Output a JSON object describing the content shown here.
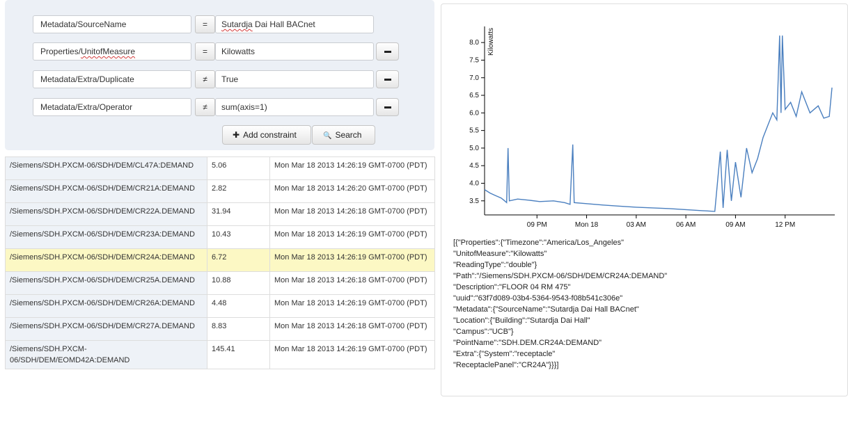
{
  "constraints": [
    {
      "field": "Metadata/SourceName",
      "op": "=",
      "value": "Sutardja Dai Hall BACnet",
      "removable": false
    },
    {
      "field": "Properties/UnitofMeasure",
      "op": "=",
      "value": "Kilowatts",
      "removable": true
    },
    {
      "field": "Metadata/Extra/Duplicate",
      "op": "≠",
      "value": "True",
      "removable": true
    },
    {
      "field": "Metadata/Extra/Operator",
      "op": "≠",
      "value": "sum(axis=1)",
      "removable": true
    }
  ],
  "buttons": {
    "add_icon": "✚",
    "add_label": "Add constraint",
    "search_icon": "🔍",
    "search_label": "Search"
  },
  "results": [
    {
      "path": "/Siemens/SDH.PXCM-06/SDH/DEM/CL47A:DEMAND",
      "value": "5.06",
      "time": "Mon Mar 18 2013 14:26:19 GMT-0700 (PDT)"
    },
    {
      "path": "/Siemens/SDH.PXCM-06/SDH/DEM/CR21A:DEMAND",
      "value": "2.82",
      "time": "Mon Mar 18 2013 14:26:20 GMT-0700 (PDT)"
    },
    {
      "path": "/Siemens/SDH.PXCM-06/SDH/DEM/CR22A.DEMAND",
      "value": "31.94",
      "time": "Mon Mar 18 2013 14:26:18 GMT-0700 (PDT)"
    },
    {
      "path": "/Siemens/SDH.PXCM-06/SDH/DEM/CR23A:DEMAND",
      "value": "10.43",
      "time": "Mon Mar 18 2013 14:26:19 GMT-0700 (PDT)"
    },
    {
      "path": "/Siemens/SDH.PXCM-06/SDH/DEM/CR24A:DEMAND",
      "value": "6.72",
      "time": "Mon Mar 18 2013 14:26:19 GMT-0700 (PDT)",
      "highlighted": true
    },
    {
      "path": "/Siemens/SDH.PXCM-06/SDH/DEM/CR25A.DEMAND",
      "value": "10.88",
      "time": "Mon Mar 18 2013 14:26:18 GMT-0700 (PDT)"
    },
    {
      "path": "/Siemens/SDH.PXCM-06/SDH/DEM/CR26A:DEMAND",
      "value": "4.48",
      "time": "Mon Mar 18 2013 14:26:19 GMT-0700 (PDT)"
    },
    {
      "path": "/Siemens/SDH.PXCM-06/SDH/DEM/CR27A.DEMAND",
      "value": "8.83",
      "time": "Mon Mar 18 2013 14:26:18 GMT-0700 (PDT)"
    },
    {
      "path": "/Siemens/SDH.PXCM-06/SDH/DEM/EOMD42A:DEMAND",
      "value": "145.41",
      "time": "Mon Mar 18 2013 14:26:19 GMT-0700 (PDT)"
    }
  ],
  "chart_data": {
    "type": "line",
    "ylabel": "Kilowatts",
    "xlabel": "",
    "title": "",
    "ylim": [
      3.1,
      8.3
    ],
    "yticks": [
      3.5,
      4.0,
      4.5,
      5.0,
      5.5,
      6.0,
      6.5,
      7.0,
      7.5,
      8.0
    ],
    "xlim": [
      "Mar 17 17:50",
      "Mar 18 15:00"
    ],
    "xticks": [
      {
        "t": "Mar 17 21:00",
        "label": "09 PM"
      },
      {
        "t": "Mar 18 00:00",
        "label": "Mon 18"
      },
      {
        "t": "Mar 18 03:00",
        "label": "03 AM"
      },
      {
        "t": "Mar 18 06:00",
        "label": "06 AM"
      },
      {
        "t": "Mar 18 09:00",
        "label": "09 AM"
      },
      {
        "t": "Mar 18 12:00",
        "label": "12 PM"
      }
    ],
    "series_color": "#4a7fbf",
    "series": [
      {
        "name": "",
        "points": [
          [
            "Mar 17 17:50",
            3.82
          ],
          [
            "Mar 17 18:10",
            3.72
          ],
          [
            "Mar 17 18:30",
            3.65
          ],
          [
            "Mar 17 18:50",
            3.58
          ],
          [
            "Mar 17 19:00",
            3.52
          ],
          [
            "Mar 17 19:10",
            3.45
          ],
          [
            "Mar 17 19:15",
            5.0
          ],
          [
            "Mar 17 19:20",
            3.5
          ],
          [
            "Mar 17 19:50",
            3.55
          ],
          [
            "Mar 17 20:30",
            3.52
          ],
          [
            "Mar 17 21:10",
            3.48
          ],
          [
            "Mar 17 22:00",
            3.5
          ],
          [
            "Mar 17 22:40",
            3.45
          ],
          [
            "Mar 17 23:00",
            3.4
          ],
          [
            "Mar 17 23:10",
            5.1
          ],
          [
            "Mar 17 23:15",
            3.45
          ],
          [
            "Mar 18 00:00",
            3.42
          ],
          [
            "Mar 18 01:00",
            3.38
          ],
          [
            "Mar 18 02:00",
            3.35
          ],
          [
            "Mar 18 03:00",
            3.32
          ],
          [
            "Mar 18 04:00",
            3.3
          ],
          [
            "Mar 18 05:00",
            3.28
          ],
          [
            "Mar 18 06:00",
            3.25
          ],
          [
            "Mar 18 07:00",
            3.22
          ],
          [
            "Mar 18 07:45",
            3.2
          ],
          [
            "Mar 18 08:05",
            4.9
          ],
          [
            "Mar 18 08:15",
            3.3
          ],
          [
            "Mar 18 08:30",
            4.95
          ],
          [
            "Mar 18 08:45",
            3.5
          ],
          [
            "Mar 18 09:00",
            4.6
          ],
          [
            "Mar 18 09:20",
            3.6
          ],
          [
            "Mar 18 09:40",
            5.0
          ],
          [
            "Mar 18 10:00",
            4.3
          ],
          [
            "Mar 18 10:20",
            4.7
          ],
          [
            "Mar 18 10:40",
            5.3
          ],
          [
            "Mar 18 11:00",
            5.7
          ],
          [
            "Mar 18 11:15",
            6.0
          ],
          [
            "Mar 18 11:30",
            5.8
          ],
          [
            "Mar 18 11:40",
            8.2
          ],
          [
            "Mar 18 11:45",
            6.0
          ],
          [
            "Mar 18 11:50",
            8.2
          ],
          [
            "Mar 18 12:00",
            6.1
          ],
          [
            "Mar 18 12:20",
            6.3
          ],
          [
            "Mar 18 12:40",
            5.9
          ],
          [
            "Mar 18 13:00",
            6.6
          ],
          [
            "Mar 18 13:30",
            6.0
          ],
          [
            "Mar 18 14:00",
            6.2
          ],
          [
            "Mar 18 14:20",
            5.85
          ],
          [
            "Mar 18 14:40",
            5.9
          ],
          [
            "Mar 18 14:50",
            6.72
          ]
        ]
      }
    ]
  },
  "json_lines": [
    "[{\"Properties\":{\"Timezone\":\"America/Los_Angeles\"",
    "\"UnitofMeasure\":\"Kilowatts\"",
    "\"ReadingType\":\"double\"}",
    "\"Path\":\"/Siemens/SDH.PXCM-06/SDH/DEM/CR24A:DEMAND\"",
    "\"Description\":\"FLOOR 04 RM 475\"",
    "\"uuid\":\"63f7d089-03b4-5364-9543-f08b541c306e\"",
    "\"Metadata\":{\"SourceName\":\"Sutardja Dai Hall BACnet\"",
    "\"Location\":{\"Building\":\"Sutardja Dai Hall\"",
    "\"Campus\":\"UCB\"}",
    "\"PointName\":\"SDH.DEM.CR24A:DEMAND\"",
    "\"Extra\":{\"System\":\"receptacle\"",
    "\"ReceptaclePanel\":\"CR24A\"}}}]"
  ]
}
